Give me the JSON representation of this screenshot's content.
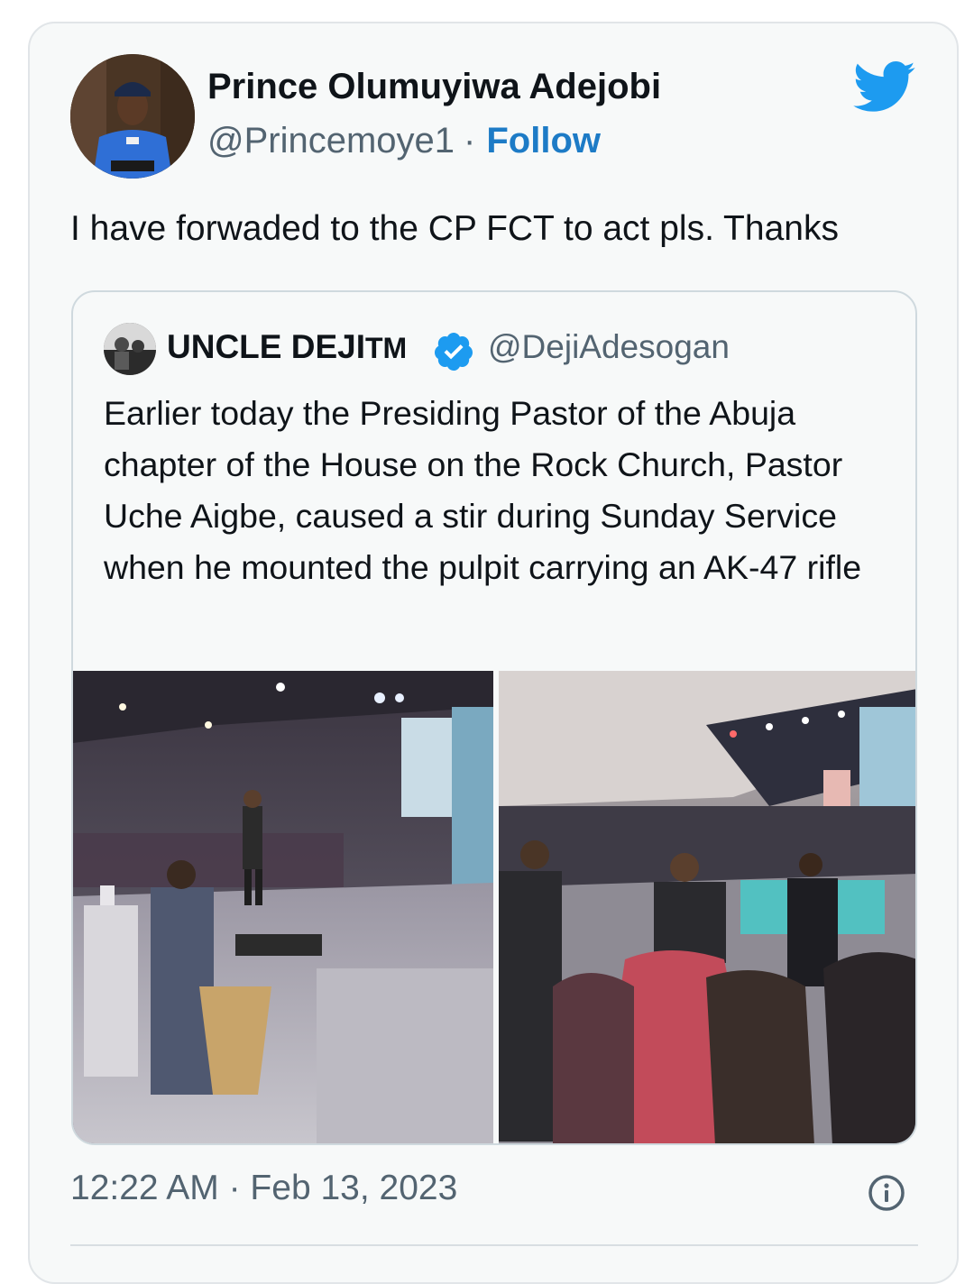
{
  "tweet": {
    "author_name": "Prince Olumuyiwa Adejobi",
    "author_handle": "@Princemoye1",
    "separator": "·",
    "follow_label": "Follow",
    "text": "I have forwaded to the CP FCT to act pls. Thanks",
    "timestamp": "12:22 AM · Feb 13, 2023"
  },
  "quoted": {
    "author_name": "UNCLE DEJI",
    "author_name_suffix": "TM",
    "author_handle": "@DejiAdesogan",
    "text": "Earlier today the Presiding Pastor of the Abuja chapter of the House on the Rock Church, Pastor Uche Aigbe, caused a stir during Sunday Service when he mounted the pulpit carrying an AK-47 rifle"
  },
  "icons": {
    "brand": "twitter-bird-icon",
    "verified": "verified-badge-icon",
    "info": "info-icon"
  },
  "colors": {
    "twitter_blue": "#1d9bf0",
    "follow_blue": "#1d7bc6",
    "text_primary": "#0f1419",
    "text_secondary": "#536471",
    "card_background": "#f7f9f9",
    "border": "#cfd9de"
  }
}
